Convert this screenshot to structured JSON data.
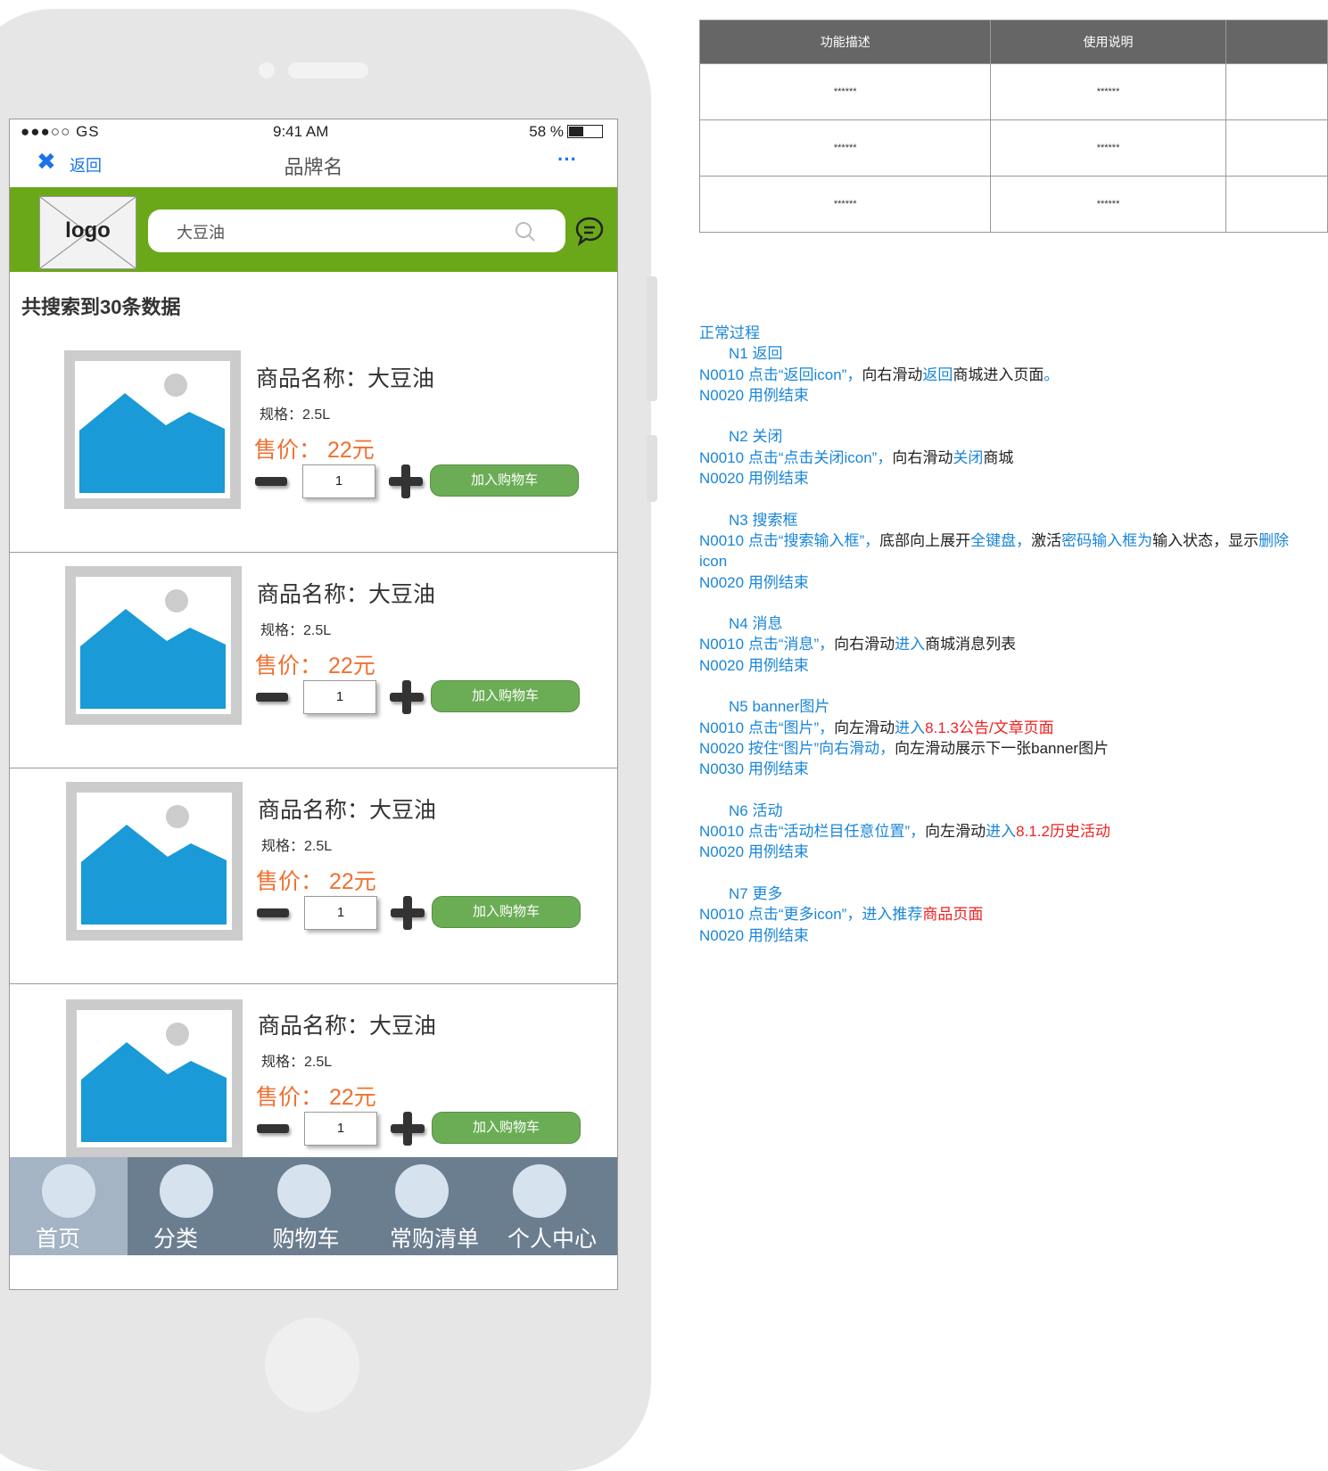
{
  "status_bar": {
    "signal": "●●●○○ GS",
    "time": "9:41 AM",
    "battery": "58 %"
  },
  "nav": {
    "close_icon": "✖",
    "back_label": "返回",
    "title": "品牌名",
    "more_label": "···"
  },
  "header": {
    "logo_text": "logo",
    "search_value": "大豆油",
    "accent_color": "#6aa81a"
  },
  "result_count": "共搜索到30条数据",
  "products": [
    {
      "name": "商品名称：大豆油",
      "spec": "规格：2.5L",
      "price": "售价： 22元",
      "qty": "1",
      "cart_label": "加入购物车"
    },
    {
      "name": "商品名称：大豆油",
      "spec": "规格：2.5L",
      "price": "售价： 22元",
      "qty": "1",
      "cart_label": "加入购物车"
    },
    {
      "name": "商品名称：大豆油",
      "spec": "规格：2.5L",
      "price": "售价： 22元",
      "qty": "1",
      "cart_label": "加入购物车"
    },
    {
      "name": "商品名称：大豆油",
      "spec": "规格：2.5L",
      "price": "售价： 22元",
      "qty": "1",
      "cart_label": "加入购物车"
    }
  ],
  "tabs": [
    {
      "label": "首页",
      "active": true
    },
    {
      "label": "分类",
      "active": false
    },
    {
      "label": "购物车",
      "active": false
    },
    {
      "label": "常购清单",
      "active": false
    },
    {
      "label": "个人中心",
      "active": false
    }
  ],
  "table": {
    "headers": [
      "功能描述",
      "使用说明",
      ""
    ],
    "rows": [
      [
        "******",
        "******",
        ""
      ],
      [
        "******",
        "******",
        ""
      ],
      [
        "******",
        "******",
        ""
      ]
    ]
  },
  "notes": {
    "heading": "正常过程",
    "sections": [
      {
        "title": "N1  返回",
        "lines": [
          [
            {
              "c": "b",
              "t": "N0010    点击“返回icon”，"
            },
            {
              "c": "k",
              "t": "向右滑动"
            },
            {
              "c": "b",
              "t": "返回"
            },
            {
              "c": "k",
              "t": "商城进入页面"
            },
            {
              "c": "b",
              "t": "。"
            }
          ],
          [
            {
              "c": "b",
              "t": "N0020    用例结束"
            }
          ]
        ]
      },
      {
        "title": "N2  关闭",
        "lines": [
          [
            {
              "c": "b",
              "t": "N0010    点击“点击关闭icon”，"
            },
            {
              "c": "k",
              "t": "向右滑动"
            },
            {
              "c": "b",
              "t": "关闭"
            },
            {
              "c": "k",
              "t": "商城"
            }
          ],
          [
            {
              "c": "b",
              "t": "N0020    用例结束"
            }
          ]
        ]
      },
      {
        "title": "N3  搜索框",
        "lines": [
          [
            {
              "c": "b",
              "t": "N0010    点击“搜索输入框”，"
            },
            {
              "c": "k",
              "t": "底部向上展开"
            },
            {
              "c": "b",
              "t": "全键盘，"
            },
            {
              "c": "k",
              "t": "激活"
            },
            {
              "c": "b",
              "t": "密码输入框为"
            },
            {
              "c": "k",
              "t": "输入状态，显示"
            },
            {
              "c": "b",
              "t": "删除"
            }
          ],
          [
            {
              "c": "b",
              "t": "icon"
            }
          ],
          [
            {
              "c": "b",
              "t": "N0020    用例结束"
            }
          ]
        ]
      },
      {
        "title": "N4  消息",
        "lines": [
          [
            {
              "c": "b",
              "t": "N0010    点击“消息”，"
            },
            {
              "c": "k",
              "t": "向右滑动"
            },
            {
              "c": "b",
              "t": "进入"
            },
            {
              "c": "k",
              "t": "商城消息列表"
            }
          ],
          [
            {
              "c": "b",
              "t": "N0020    用例结束"
            }
          ]
        ]
      },
      {
        "title": "N5  banner图片",
        "lines": [
          [
            {
              "c": "b",
              "t": "N0010    点击“图片”，"
            },
            {
              "c": "k",
              "t": "向左滑动"
            },
            {
              "c": "b",
              "t": "进入"
            },
            {
              "c": "r",
              "t": "8.1.3公告/文章页面"
            }
          ],
          [
            {
              "c": "b",
              "t": "N0020    按住“图片”向右滑动，"
            },
            {
              "c": "k",
              "t": "向左滑动展示下一张banner图片"
            }
          ],
          [
            {
              "c": "b",
              "t": "N0030    用例结束"
            }
          ]
        ]
      },
      {
        "title": "N6   活动",
        "lines": [
          [
            {
              "c": "b",
              "t": "N0010    点击“活动栏目任意位置”，"
            },
            {
              "c": "k",
              "t": "向左滑动"
            },
            {
              "c": "b",
              "t": "进入"
            },
            {
              "c": "r",
              "t": "8.1.2历史活动"
            }
          ],
          [
            {
              "c": "b",
              "t": "N0020    用例结束"
            }
          ]
        ]
      },
      {
        "title": "N7  更多",
        "lines": [
          [
            {
              "c": "b",
              "t": "N0010    点击“更多icon”，进入推荐"
            },
            {
              "c": "r",
              "t": "商品页面"
            }
          ],
          [
            {
              "c": "b",
              "t": "N0020    用例结束"
            }
          ]
        ]
      }
    ]
  }
}
